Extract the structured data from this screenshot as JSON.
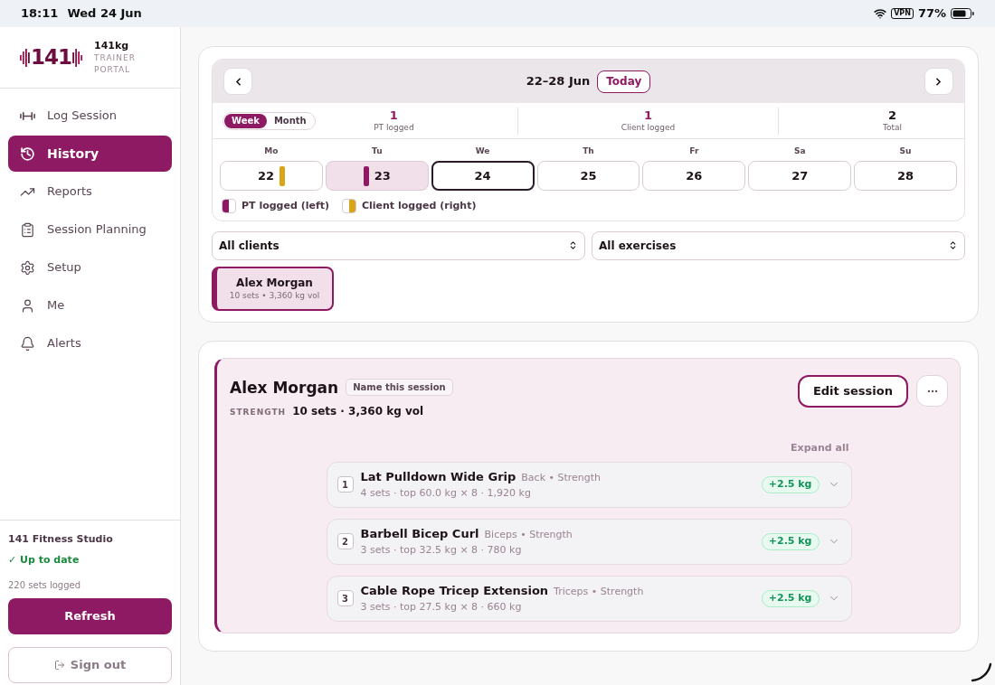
{
  "status_bar": {
    "time": "18:11",
    "date": "Wed 24 Jun",
    "vpn": "VPN",
    "battery": "77%"
  },
  "sidebar": {
    "brand": {
      "logo": "141",
      "name": "141kg",
      "subtitle": "TRAINER PORTAL"
    },
    "nav": [
      {
        "label": "Log Session",
        "selected": false
      },
      {
        "label": "History",
        "selected": true
      },
      {
        "label": "Reports",
        "selected": false
      },
      {
        "label": "Session Planning",
        "selected": false
      },
      {
        "label": "Setup",
        "selected": false
      },
      {
        "label": "Me",
        "selected": false
      },
      {
        "label": "Alerts",
        "selected": false
      }
    ],
    "footer": {
      "studio": "141 Fitness Studio",
      "sync_status": "✓ Up to date",
      "sets_logged": "220 sets logged",
      "refresh": "Refresh",
      "sign_out": "Sign out"
    }
  },
  "calendar": {
    "range": "22–28 Jun",
    "today_button": "Today",
    "views": [
      {
        "label": "Week",
        "selected": true
      },
      {
        "label": "Month",
        "selected": false
      }
    ],
    "stats": [
      {
        "value": "1",
        "label": "PT logged",
        "kind": "logged"
      },
      {
        "value": "1",
        "label": "Client logged",
        "kind": "logged"
      },
      {
        "value": "2",
        "label": "Total",
        "kind": "total"
      }
    ],
    "days": [
      {
        "weekday": "Mo",
        "date": "22",
        "pt_logged": false,
        "client_logged": true,
        "selected": false,
        "today": false
      },
      {
        "weekday": "Tu",
        "date": "23",
        "pt_logged": true,
        "client_logged": false,
        "selected": true,
        "today": false
      },
      {
        "weekday": "We",
        "date": "24",
        "pt_logged": false,
        "client_logged": false,
        "selected": false,
        "today": true
      },
      {
        "weekday": "Th",
        "date": "25",
        "pt_logged": false,
        "client_logged": false,
        "selected": false,
        "today": false
      },
      {
        "weekday": "Fr",
        "date": "26",
        "pt_logged": false,
        "client_logged": false,
        "selected": false,
        "today": false
      },
      {
        "weekday": "Sa",
        "date": "27",
        "pt_logged": false,
        "client_logged": false,
        "selected": false,
        "today": false
      },
      {
        "weekday": "Su",
        "date": "28",
        "pt_logged": false,
        "client_logged": false,
        "selected": false,
        "today": false
      }
    ],
    "legend": [
      {
        "label": "PT logged (left)",
        "kind": "left",
        "color": "#8e1a63"
      },
      {
        "label": "Client logged (right)",
        "kind": "right",
        "color": "#d9a514"
      }
    ]
  },
  "filters": [
    {
      "value": "All clients"
    },
    {
      "value": "All exercises"
    }
  ],
  "clients": [
    {
      "name": "Alex Morgan",
      "summary": "10 sets • 3,360 kg vol",
      "selected": true
    }
  ],
  "session": {
    "client": "Alex Morgan",
    "name_button": "Name this session",
    "type": "STRENGTH",
    "summary": "10 sets · 3,360 kg vol",
    "edit_button": "Edit session",
    "expand_all": "Expand all",
    "exercises": [
      {
        "number": "1",
        "name": "Lat Pulldown Wide Grip",
        "tags": "Back • Strength",
        "detail": "4 sets · top 60.0 kg × 8 · 1,920 kg",
        "change": "+2.5 kg",
        "expanded": false
      },
      {
        "number": "2",
        "name": "Barbell Bicep Curl",
        "tags": "Biceps • Strength",
        "detail": "3 sets · top 32.5 kg × 8 · 780 kg",
        "change": "+2.5 kg",
        "expanded": false
      },
      {
        "number": "3",
        "name": "Cable Rope Tricep Extension",
        "tags": "Triceps • Strength",
        "detail": "3 sets · top 27.5 kg × 8 · 660 kg",
        "change": "+2.5 kg",
        "expanded": false
      }
    ]
  }
}
